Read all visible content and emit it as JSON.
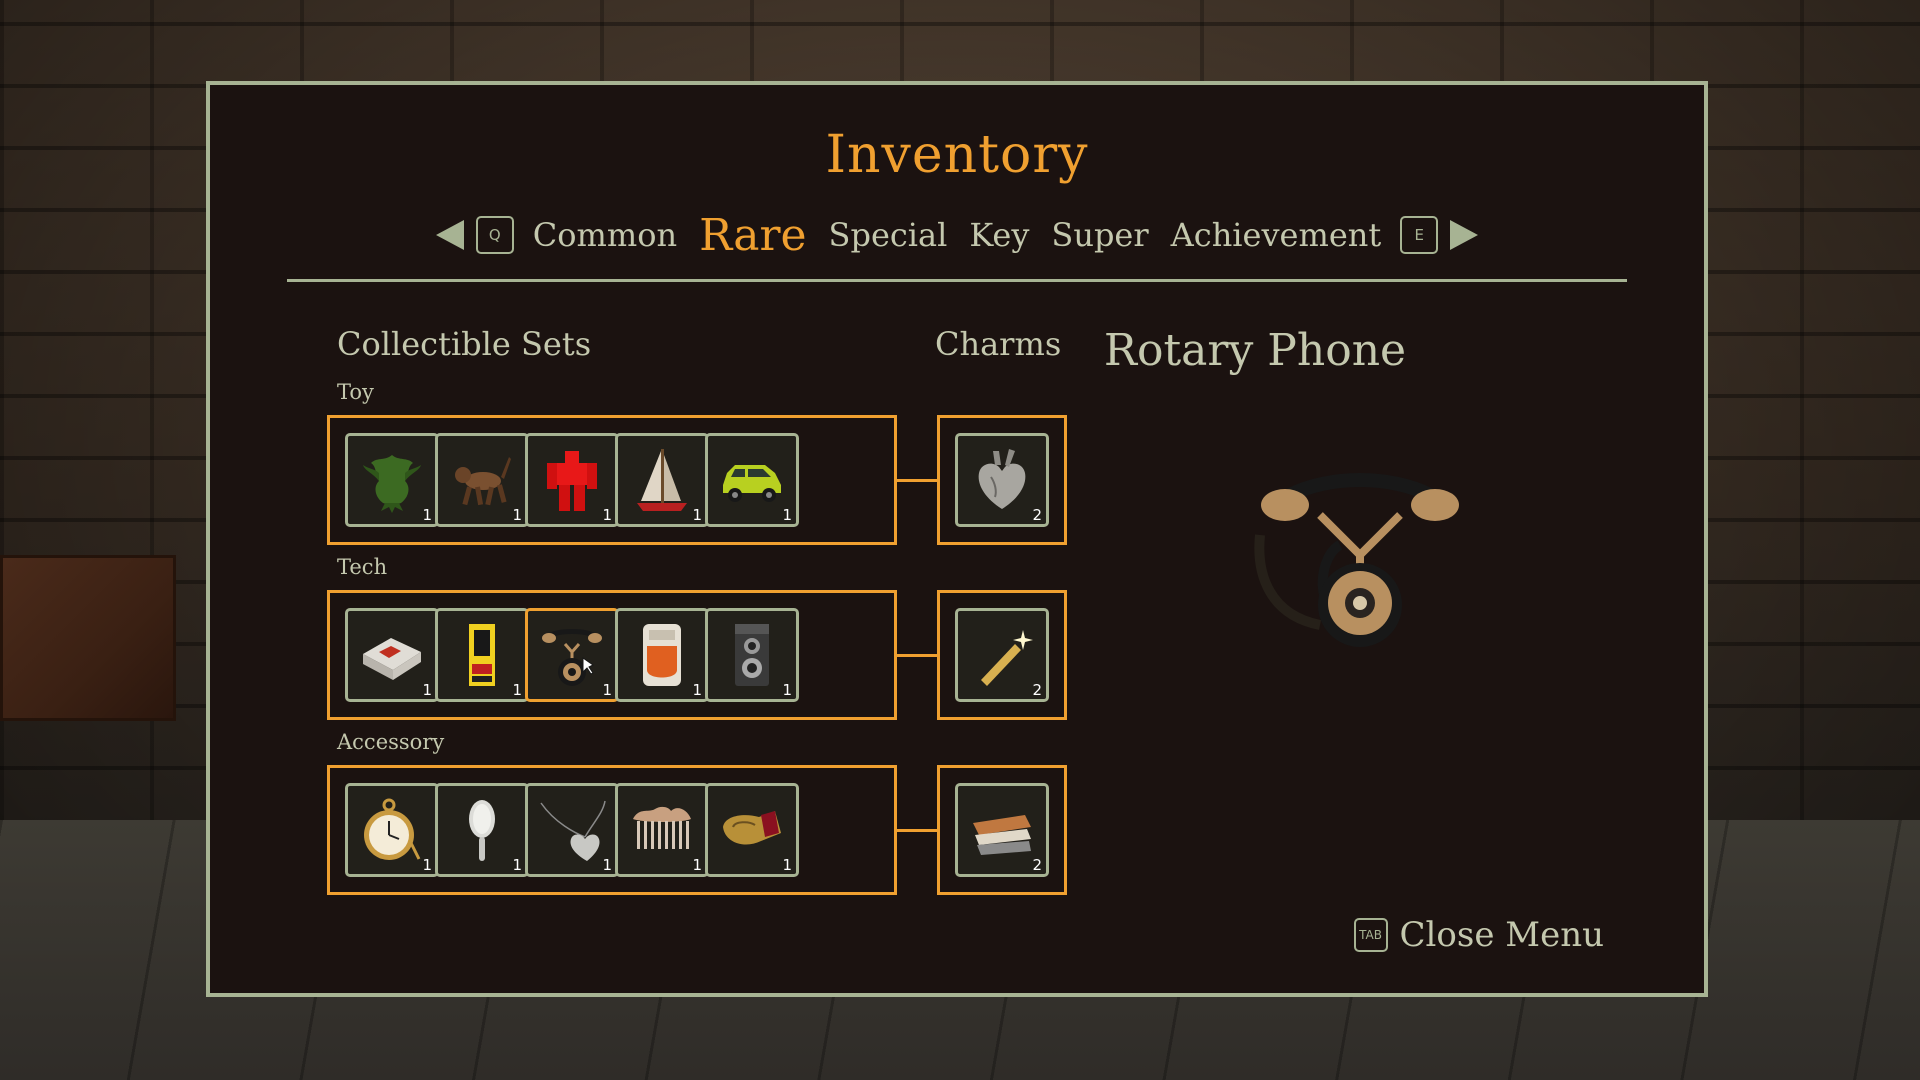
{
  "title": "Inventory",
  "nav": {
    "prev_key": "Q",
    "next_key": "E",
    "tabs": [
      {
        "label": "Common",
        "active": false
      },
      {
        "label": "Rare",
        "active": true
      },
      {
        "label": "Special",
        "active": false
      },
      {
        "label": "Key",
        "active": false
      },
      {
        "label": "Super",
        "active": false
      },
      {
        "label": "Achievement",
        "active": false
      }
    ]
  },
  "sections": {
    "collectible_sets": "Collectible Sets",
    "charms": "Charms"
  },
  "sets": [
    {
      "label": "Toy",
      "items": [
        {
          "icon": "dragon-icon",
          "count": "1"
        },
        {
          "icon": "toy-dog-icon",
          "count": "1"
        },
        {
          "icon": "red-robot-icon",
          "count": "1"
        },
        {
          "icon": "sailboat-icon",
          "count": "1"
        },
        {
          "icon": "toy-car-icon",
          "count": "1"
        }
      ],
      "charm": {
        "icon": "heart-organ-icon",
        "count": "2"
      }
    },
    {
      "label": "Tech",
      "items": [
        {
          "icon": "cassette-player-icon",
          "count": "1"
        },
        {
          "icon": "arcade-machine-icon",
          "count": "1"
        },
        {
          "icon": "rotary-phone-icon",
          "count": "1",
          "selected": true
        },
        {
          "icon": "radio-icon",
          "count": "1"
        },
        {
          "icon": "camera-icon",
          "count": "1"
        }
      ],
      "charm": {
        "icon": "sparkler-icon",
        "count": "2"
      }
    },
    {
      "label": "Accessory",
      "items": [
        {
          "icon": "pocket-watch-icon",
          "count": "1"
        },
        {
          "icon": "hand-mirror-icon",
          "count": "1"
        },
        {
          "icon": "heart-locket-icon",
          "count": "1"
        },
        {
          "icon": "hair-comb-icon",
          "count": "1"
        },
        {
          "icon": "ruby-ring-icon",
          "count": "1"
        }
      ],
      "charm": {
        "icon": "stacked-planks-icon",
        "count": "2"
      }
    }
  ],
  "detail": {
    "name": "Rotary Phone",
    "icon": "rotary-phone-icon"
  },
  "close": {
    "key": "TAB",
    "label": "Close Menu"
  },
  "colors": {
    "accent": "#f0a030",
    "frame": "#a7b393",
    "text": "#c4c8ae",
    "panel": "#1b1210"
  }
}
